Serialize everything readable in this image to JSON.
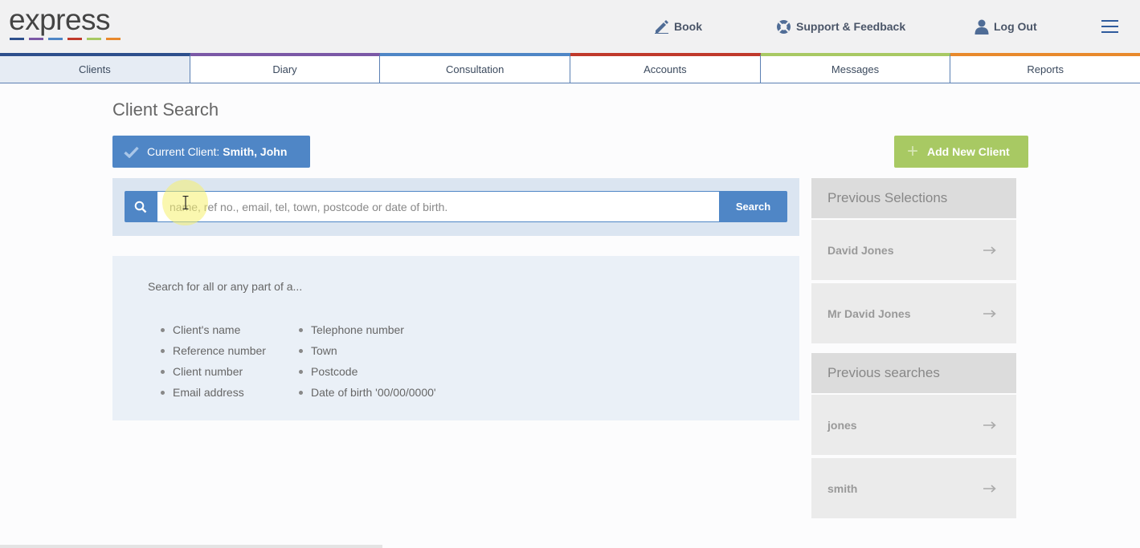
{
  "brand": {
    "logo_text": "express",
    "bar_colors": [
      "#2d4f8c",
      "#7b58a6",
      "#4f86c6",
      "#c0392b",
      "#a8c963",
      "#e8892c"
    ]
  },
  "header": {
    "book_label": "Book",
    "support_label": "Support & Feedback",
    "logout_label": "Log Out"
  },
  "tabs": [
    {
      "label": "Clients",
      "color": "#2d4f8c",
      "active": true
    },
    {
      "label": "Diary",
      "color": "#7b58a6",
      "active": false
    },
    {
      "label": "Consultation",
      "color": "#4f86c6",
      "active": false
    },
    {
      "label": "Accounts",
      "color": "#c0392b",
      "active": false
    },
    {
      "label": "Messages",
      "color": "#a8c963",
      "active": false
    },
    {
      "label": "Reports",
      "color": "#e8892c",
      "active": false
    }
  ],
  "page": {
    "title": "Client Search",
    "current_client_prefix": "Current Client:",
    "current_client_name": "Smith, John",
    "add_client_label": "Add New Client"
  },
  "search": {
    "placeholder": "name, ref no., email, tel, town, postcode or date of birth.",
    "value": "",
    "button_label": "Search"
  },
  "help": {
    "intro": "Search for all or any part of a...",
    "col1": [
      "Client's name",
      "Reference number",
      "Client number",
      "Email address"
    ],
    "col2": [
      "Telephone number",
      "Town",
      "Postcode",
      "Date of birth '00/00/0000'"
    ]
  },
  "sidebar": {
    "previous_selections_title": "Previous Selections",
    "previous_selections": [
      "David Jones",
      "Mr David Jones"
    ],
    "previous_searches_title": "Previous searches",
    "previous_searches": [
      "jones",
      "smith"
    ]
  }
}
